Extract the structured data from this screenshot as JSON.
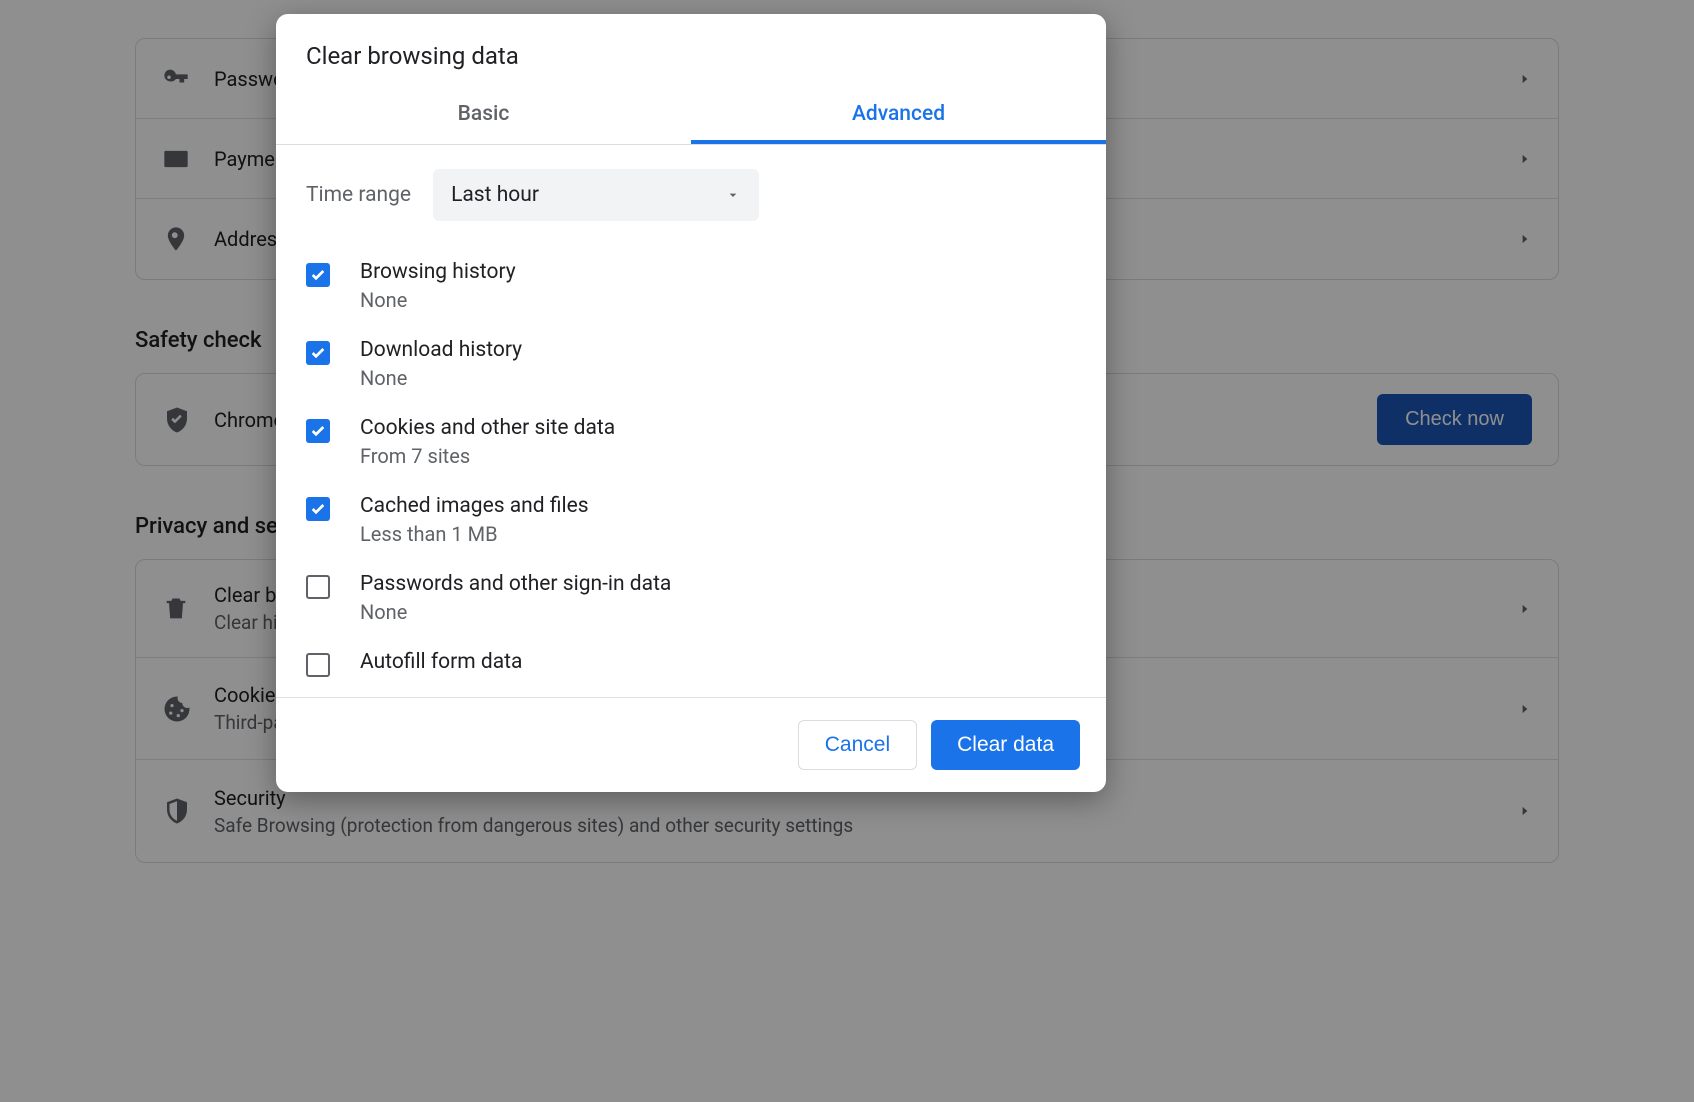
{
  "background": {
    "autofill": {
      "items": [
        {
          "label": "Passwords"
        },
        {
          "label": "Payment methods"
        },
        {
          "label": "Addresses and more"
        }
      ]
    },
    "safety": {
      "title": "Safety check",
      "row_text": "Chrome can help keep you safe from data breaches, bad extensions, and more",
      "button": "Check now"
    },
    "privacy": {
      "title": "Privacy and security",
      "clear": {
        "title": "Clear browsing data",
        "sub": "Clear history, cookies, cache, and more"
      },
      "cookies": {
        "title": "Cookies and other site data",
        "sub": "Third-party cookies are blocked in Incognito mode"
      },
      "security": {
        "title": "Security",
        "sub": "Safe Browsing (protection from dangerous sites) and other security settings"
      }
    }
  },
  "dialog": {
    "title": "Clear browsing data",
    "tabs": {
      "basic": "Basic",
      "advanced": "Advanced"
    },
    "time_label": "Time range",
    "time_value": "Last hour",
    "items": [
      {
        "title": "Browsing history",
        "sub": "None",
        "checked": true
      },
      {
        "title": "Download history",
        "sub": "None",
        "checked": true
      },
      {
        "title": "Cookies and other site data",
        "sub": "From 7 sites",
        "checked": true
      },
      {
        "title": "Cached images and files",
        "sub": "Less than 1 MB",
        "checked": true
      },
      {
        "title": "Passwords and other sign-in data",
        "sub": "None",
        "checked": false
      },
      {
        "title": "Autofill form data",
        "sub": "",
        "checked": false
      }
    ],
    "cancel": "Cancel",
    "clear": "Clear data"
  }
}
